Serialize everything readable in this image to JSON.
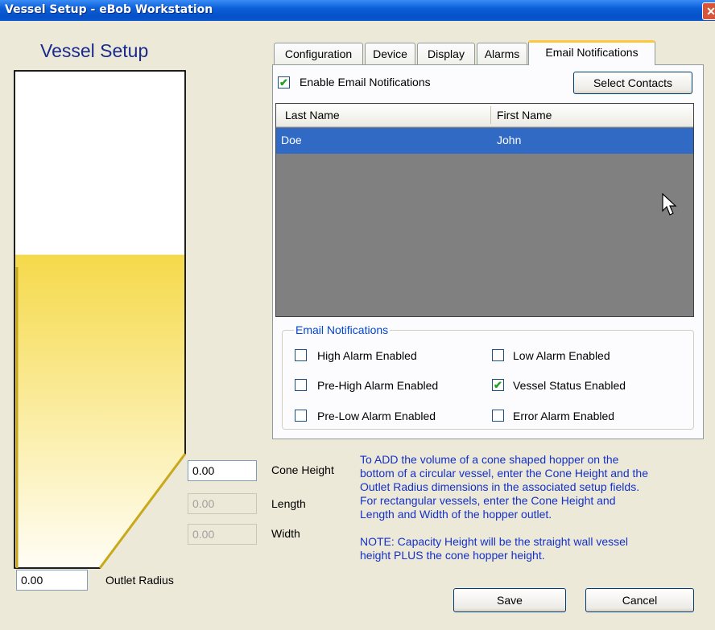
{
  "window": {
    "title": "Vessel Setup - eBob Workstation",
    "close_glyph": "✕"
  },
  "vessel": {
    "heading": "Vessel Setup",
    "fill_level_percent": 63
  },
  "fields": {
    "cone_height": {
      "label": "Cone Height",
      "value": "0.00"
    },
    "length": {
      "label": "Length",
      "value": "0.00"
    },
    "width": {
      "label": "Width",
      "value": "0.00"
    },
    "outlet_radius": {
      "label": "Outlet Radius",
      "value": "0.00"
    }
  },
  "tabs": [
    "Configuration",
    "Device",
    "Display",
    "Alarms",
    "Email Notifications"
  ],
  "active_tab": "Email Notifications",
  "email": {
    "enable_label": "Enable Email Notifications",
    "enable_checked": true,
    "select_contacts_label": "Select Contacts",
    "grid": {
      "columns": [
        "Last Name",
        "First Name"
      ],
      "rows": [
        {
          "last": "Doe",
          "first": "John"
        }
      ]
    },
    "group_title": "Email Notifications",
    "options": {
      "high_alarm": {
        "label": "High Alarm Enabled",
        "checked": false
      },
      "low_alarm": {
        "label": "Low Alarm Enabled",
        "checked": false
      },
      "pre_high_alarm": {
        "label": "Pre-High Alarm Enabled",
        "checked": false
      },
      "vessel_status": {
        "label": "Vessel Status Enabled",
        "checked": true
      },
      "pre_low_alarm": {
        "label": "Pre-Low Alarm Enabled",
        "checked": false
      },
      "error_alarm": {
        "label": "Error Alarm Enabled",
        "checked": false
      }
    }
  },
  "info": {
    "line1": "To ADD the volume of a cone shaped hopper on the",
    "line2": "bottom of a circular vessel, enter the Cone Height and the",
    "line3": "Outlet Radius dimensions in the associated setup fields.",
    "line4": "For rectangular vessels, enter the Cone Height and",
    "line5": "Length and Width of the hopper outlet.",
    "note1": "NOTE:  Capacity Height will be the straight wall vessel",
    "note2": "height PLUS the cone hopper height."
  },
  "buttons": {
    "save": "Save",
    "cancel": "Cancel"
  },
  "colors": {
    "title_bar": "#0a5fd8",
    "fill": "#f5d94a",
    "selection": "#316ac5",
    "info_text": "#1530c8",
    "tab_highlight": "#ffc83c"
  },
  "icons": {
    "check": "✔",
    "cursor": "arrow-cursor-icon"
  }
}
